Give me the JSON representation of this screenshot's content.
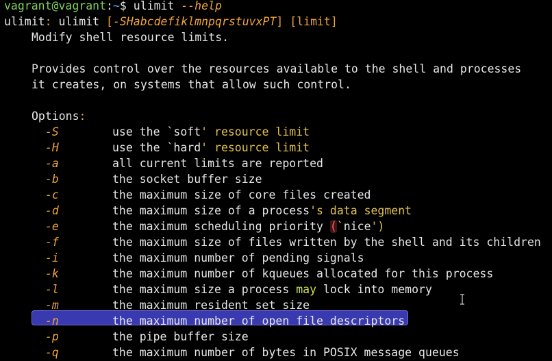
{
  "prompt": {
    "user_host": "vagrant@vagrant",
    "sep": ":",
    "path": "~",
    "symbol": "$",
    "command": "ulimit",
    "flag": "--help"
  },
  "usage": {
    "prefix": "ulimit",
    "colon": ":",
    "name": "ulimit",
    "bracket_open": "[",
    "flags": "-SHabcdefiklmnpqrstuvxPT",
    "bracket_close": "]",
    "limit": "[limit]"
  },
  "summary": "Modify shell resource limits.",
  "description": [
    "Provides control over the resources available to the shell and processes",
    "it creates, on systems that allow such control."
  ],
  "options_heading": "Options",
  "options_colon": ":",
  "options": [
    {
      "flag": "-S",
      "parts": [
        {
          "t": "use the `soft",
          "c": "w"
        },
        {
          "t": "' resource limit",
          "c": "y"
        }
      ]
    },
    {
      "flag": "-H",
      "parts": [
        {
          "t": "use the `hard",
          "c": "w"
        },
        {
          "t": "' resource limit",
          "c": "y"
        }
      ]
    },
    {
      "flag": "-a",
      "parts": [
        {
          "t": "all current limits are reported",
          "c": "w"
        }
      ]
    },
    {
      "flag": "-b",
      "parts": [
        {
          "t": "the socket buffer size",
          "c": "w"
        }
      ]
    },
    {
      "flag": "-c",
      "parts": [
        {
          "t": "the maximum size of core files created",
          "c": "w"
        }
      ]
    },
    {
      "flag": "-d",
      "parts": [
        {
          "t": "the maximum size of a process",
          "c": "w"
        },
        {
          "t": "'s data segment",
          "c": "y"
        }
      ]
    },
    {
      "flag": "-e",
      "parts": [
        {
          "t": "the maximum scheduling priority ",
          "c": "w"
        },
        {
          "t": "(",
          "c": "r"
        },
        {
          "t": "`nice",
          "c": "w"
        },
        {
          "t": "')",
          "c": "y"
        }
      ]
    },
    {
      "flag": "-f",
      "parts": [
        {
          "t": "the maximum size of files written by the shell and its children",
          "c": "w"
        }
      ]
    },
    {
      "flag": "-i",
      "parts": [
        {
          "t": "the maximum number of pending signals",
          "c": "w"
        }
      ]
    },
    {
      "flag": "-k",
      "parts": [
        {
          "t": "the maximum number of kqueues allocated for this process",
          "c": "w"
        }
      ]
    },
    {
      "flag": "-l",
      "parts": [
        {
          "t": "the maximum size a process ",
          "c": "w"
        },
        {
          "t": "may",
          "c": "g"
        },
        {
          "t": " lock into memory",
          "c": "w"
        }
      ]
    },
    {
      "flag": "-m",
      "parts": [
        {
          "t": "the maximum resident set size",
          "c": "w"
        }
      ]
    },
    {
      "flag": "-n",
      "parts": [
        {
          "t": "the maximum number of open file descriptors",
          "c": "w"
        }
      ],
      "highlighted": true
    },
    {
      "flag": "-p",
      "parts": [
        {
          "t": "the pipe buffer size",
          "c": "w"
        }
      ]
    },
    {
      "flag": "-q",
      "parts": [
        {
          "t": "the maximum number of bytes in POSIX message queues",
          "c": "w"
        }
      ]
    }
  ],
  "colors": {
    "background": "#000000",
    "text": "#e6e6e6",
    "prompt_user": "#7fd15a",
    "prompt_path": "#6aa2ff",
    "flag": "#f0a33a",
    "quote_text": "#e0c14c",
    "keyword": "#cfe04a",
    "selection": "#3a3ab0",
    "paren_error": "#ff6060"
  }
}
